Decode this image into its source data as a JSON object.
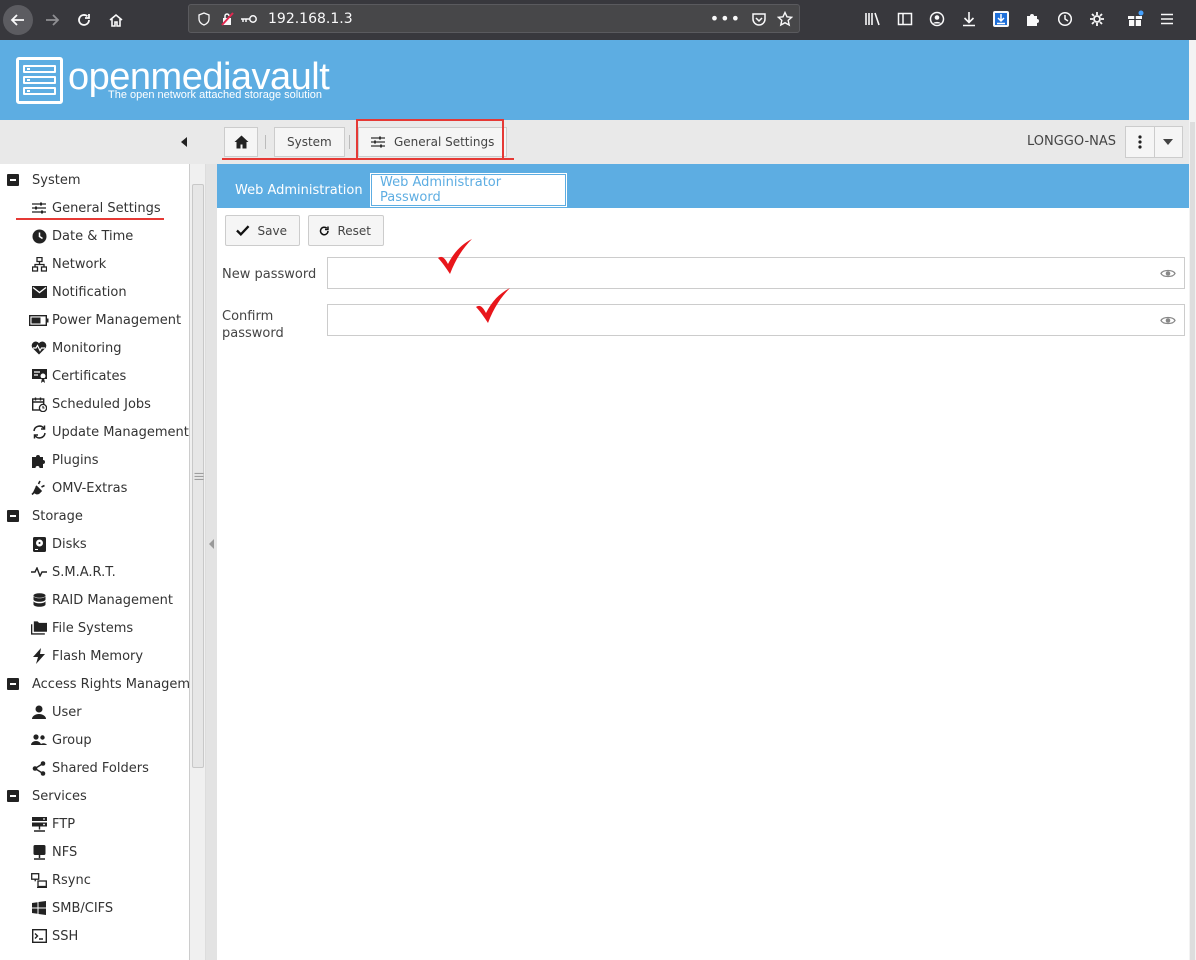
{
  "browser": {
    "url": "192.168.1.3"
  },
  "brand": {
    "name": "openmediavault",
    "tagline": "The open network attached storage solution"
  },
  "breadcrumb": {
    "items": [
      "System",
      "General Settings"
    ]
  },
  "header": {
    "hostname": "LONGGO-NAS"
  },
  "tabs": [
    {
      "label": "Web Administration"
    },
    {
      "label": "Web Administrator Password"
    }
  ],
  "toolbar": {
    "save_label": "Save",
    "reset_label": "Reset"
  },
  "form": {
    "new_password_label": "New password",
    "confirm_password_label_line1": "Confirm",
    "confirm_password_label_line2": "password",
    "new_password_value": "",
    "confirm_password_value": ""
  },
  "sidebar": {
    "groups": [
      {
        "label": "System",
        "items": [
          "General Settings",
          "Date & Time",
          "Network",
          "Notification",
          "Power Management",
          "Monitoring",
          "Certificates",
          "Scheduled Jobs",
          "Update Management",
          "Plugins",
          "OMV-Extras"
        ]
      },
      {
        "label": "Storage",
        "items": [
          "Disks",
          "S.M.A.R.T.",
          "RAID Management",
          "File Systems",
          "Flash Memory"
        ]
      },
      {
        "label": "Access Rights Management",
        "items": [
          "User",
          "Group",
          "Shared Folders"
        ]
      },
      {
        "label": "Services",
        "items": [
          "FTP",
          "NFS",
          "Rsync",
          "SMB/CIFS",
          "SSH"
        ]
      }
    ]
  },
  "colors": {
    "accent": "#5dade2",
    "highlight": "#e53935"
  }
}
